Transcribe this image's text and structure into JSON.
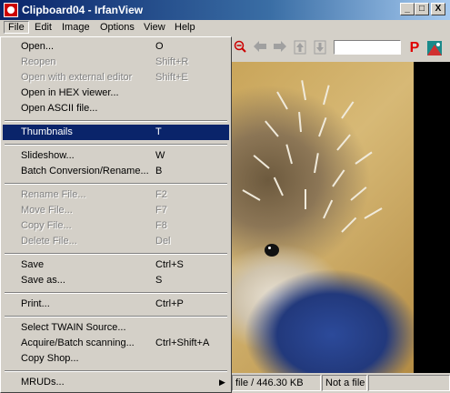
{
  "window": {
    "title": "Clipboard04 - IrfanView"
  },
  "titlebar_buttons": {
    "minimize": "_",
    "maximize": "□",
    "close": "X"
  },
  "menubar": [
    "File",
    "Edit",
    "Image",
    "Options",
    "View",
    "Help"
  ],
  "file_menu": [
    {
      "label": "Open...",
      "shortcut": "O",
      "disabled": false
    },
    {
      "label": "Reopen",
      "shortcut": "Shift+R",
      "disabled": true
    },
    {
      "label": "Open with external editor",
      "shortcut": "Shift+E",
      "disabled": true
    },
    {
      "label": "Open in HEX viewer...",
      "shortcut": "",
      "disabled": false
    },
    {
      "label": "Open ASCII file...",
      "shortcut": "",
      "disabled": false
    },
    {
      "label": "Thumbnails",
      "shortcut": "T",
      "disabled": false,
      "selected": true
    },
    {
      "label": "Slideshow...",
      "shortcut": "W",
      "disabled": false
    },
    {
      "label": "Batch Conversion/Rename...",
      "shortcut": "B",
      "disabled": false
    },
    {
      "label": "Rename File...",
      "shortcut": "F2",
      "disabled": true
    },
    {
      "label": "Move File...",
      "shortcut": "F7",
      "disabled": true
    },
    {
      "label": "Copy File...",
      "shortcut": "F8",
      "disabled": true
    },
    {
      "label": "Delete File...",
      "shortcut": "Del",
      "disabled": true
    },
    {
      "label": "Save",
      "shortcut": "Ctrl+S",
      "disabled": false
    },
    {
      "label": "Save as...",
      "shortcut": "S",
      "disabled": false
    },
    {
      "label": "Print...",
      "shortcut": "Ctrl+P",
      "disabled": false
    },
    {
      "label": "Select TWAIN Source...",
      "shortcut": "",
      "disabled": false
    },
    {
      "label": "Acquire/Batch scanning...",
      "shortcut": "Ctrl+Shift+A",
      "disabled": false
    },
    {
      "label": "Copy Shop...",
      "shortcut": "",
      "disabled": false
    },
    {
      "label": "MRUDs...",
      "shortcut": "",
      "disabled": false,
      "submenu": true
    }
  ],
  "toolbar": {
    "icons": [
      "zoom-out-icon",
      "prev-icon",
      "next-icon",
      "first-icon",
      "last-icon",
      "search-input",
      "paint-icon",
      "logo-icon"
    ],
    "search_value": "",
    "paint_glyph": "P"
  },
  "statusbar": {
    "filesize": "file / 446.30 KB",
    "filename": "Not a file"
  }
}
